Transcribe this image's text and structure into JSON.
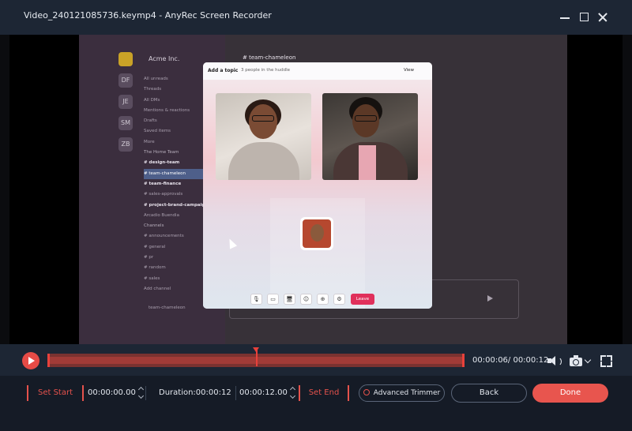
{
  "window": {
    "title": "Video_240121085736.keymp4  -  AnyRec Screen Recorder"
  },
  "preview": {
    "workspaces": [
      "",
      "DF",
      "JE",
      "SM",
      "ZB"
    ],
    "org_name": "Acme Inc.",
    "sidebar_items": [
      {
        "label": "All unreads",
        "style": "normal"
      },
      {
        "label": "Threads",
        "style": "normal"
      },
      {
        "label": "All DMs",
        "style": "normal"
      },
      {
        "label": "Mentions & reactions",
        "style": "normal"
      },
      {
        "label": "Drafts",
        "style": "normal"
      },
      {
        "label": "Saved items",
        "style": "normal"
      },
      {
        "label": "More",
        "style": "normal"
      },
      {
        "label": "The Home Team",
        "style": "hdr"
      },
      {
        "label": "# design-team",
        "style": "bold"
      },
      {
        "label": "# team-chameleon",
        "style": "sel"
      },
      {
        "label": "# team-finance",
        "style": "bold"
      },
      {
        "label": "# sales-approvals",
        "style": "normal"
      },
      {
        "label": "# project-brand-campaign",
        "style": "bold"
      },
      {
        "label": "Arcadio Buendia",
        "style": "normal"
      },
      {
        "label": "Channels",
        "style": "hdr"
      },
      {
        "label": "# announcements",
        "style": "normal"
      },
      {
        "label": "# general",
        "style": "normal"
      },
      {
        "label": "# pr",
        "style": "normal"
      },
      {
        "label": "# random",
        "style": "normal"
      },
      {
        "label": "# sales",
        "style": "normal"
      },
      {
        "label": "Add channel",
        "style": "normal"
      }
    ],
    "sidebar_footer": "team-chameleon",
    "channel_title": "# team-chameleon",
    "huddle": {
      "topic_label": "Add a topic",
      "subtitle": "3 people in the huddle",
      "view_label": "View",
      "controls": [
        "🎙",
        "▭",
        "🖥",
        "☺",
        "⊕",
        "⚙"
      ],
      "leave_label": "Leave"
    }
  },
  "timeline": {
    "timecode": "00:00:06/ 00:00:12",
    "progress": 0.5
  },
  "trim": {
    "set_start_label": "Set Start",
    "start_time": "00:00:00.00",
    "duration": "Duration:00:00:12",
    "end_time": "00:00:12.00",
    "set_end_label": "Set End",
    "advanced_trimmer_label": "Advanced Trimmer",
    "back_label": "Back",
    "done_label": "Done"
  },
  "colors": {
    "accent": "#e8554e",
    "panel": "#1d2634",
    "bottom": "#151b26"
  }
}
